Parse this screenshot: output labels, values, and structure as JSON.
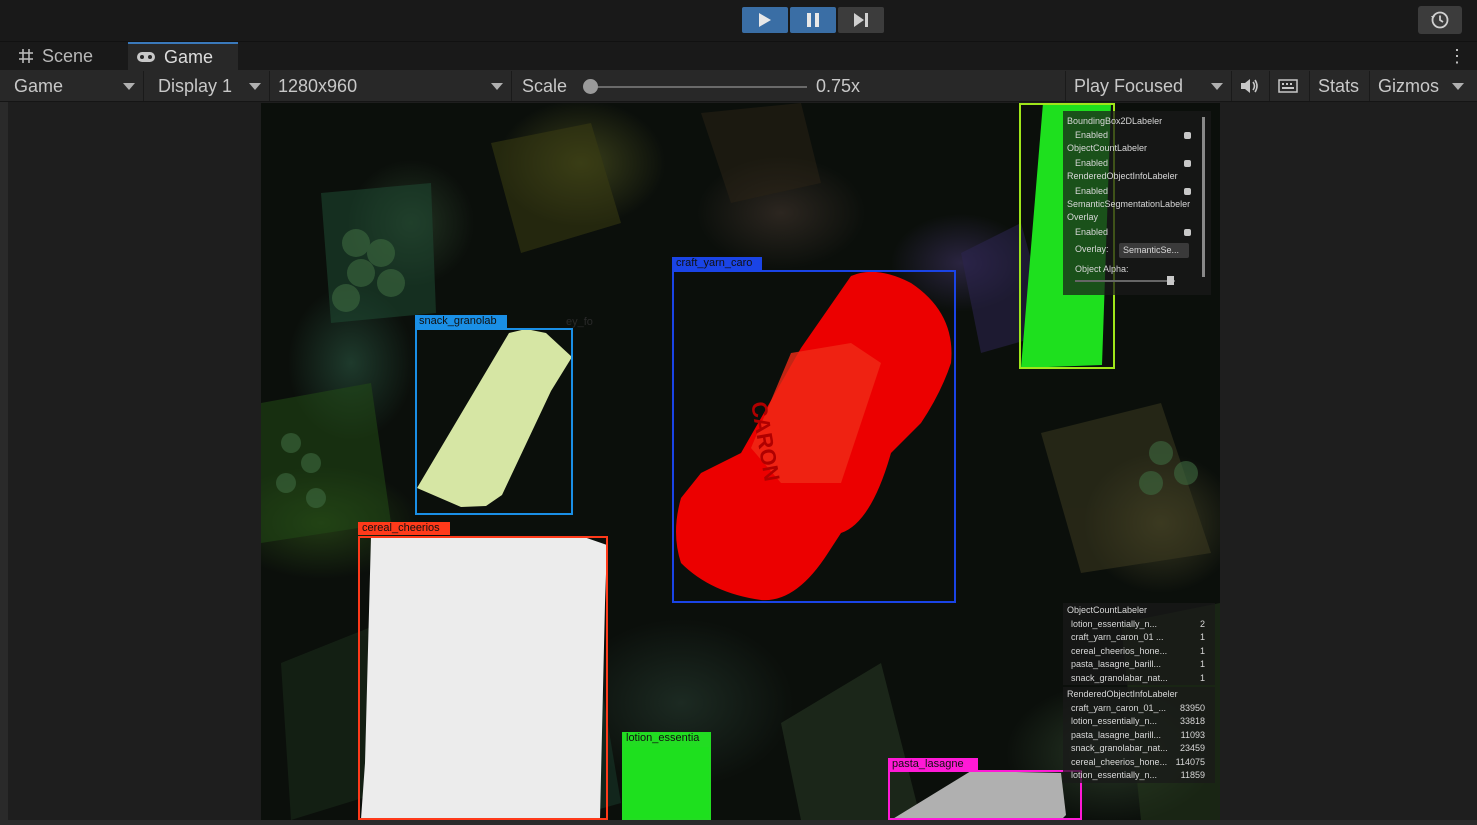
{
  "toolbar": {
    "play_icon": "play-icon",
    "pause_icon": "pause-icon",
    "step_icon": "step-icon",
    "history_icon": "history-icon"
  },
  "tabs": [
    {
      "label": "Scene",
      "icon": "grid-icon"
    },
    {
      "label": "Game",
      "icon": "gamepad-icon"
    }
  ],
  "gamebar": {
    "view_mode": "Game",
    "display": "Display 1",
    "resolution": "1280x960",
    "scale_label": "Scale",
    "scale_value": "0.75x",
    "scale_fraction": 0.03,
    "play_mode": "Play Focused",
    "stats": "Stats",
    "gizmos": "Gizmos"
  },
  "scene": {
    "bboxes": [
      {
        "label": "craft_yarn_caro",
        "color": "#1a44e6"
      },
      {
        "label": "snack_granolab",
        "color": "#1a8fe6"
      },
      {
        "label": "cereal_cheerios",
        "color": "#ff3a1a"
      },
      {
        "label": "lotion_essentia",
        "color": "#22dd22"
      },
      {
        "label": "pasta_lasagne",
        "color": "#ff19d6"
      },
      {
        "label": "",
        "color": "#9fe61a"
      }
    ],
    "fragment_text": "ey_fo",
    "brand_text": "CARON"
  },
  "labeler_panel": {
    "rows": [
      {
        "text": "BoundingBox2DLabeler"
      },
      {
        "text": "Enabled"
      },
      {
        "text": "ObjectCountLabeler"
      },
      {
        "text": "Enabled"
      },
      {
        "text": "RenderedObjectInfoLabeler"
      },
      {
        "text": "Enabled"
      },
      {
        "text": "SemanticSegmentationLabeler"
      },
      {
        "text": "Overlay"
      },
      {
        "text": "Enabled"
      }
    ],
    "overlay_label": "Overlay:",
    "overlay_value": "SemanticSe...",
    "alpha_label": "Object Alpha:"
  },
  "object_count": {
    "title": "ObjectCountLabeler",
    "rows": [
      {
        "name": "lotion_essentially_n...",
        "value": "2"
      },
      {
        "name": "craft_yarn_caron_01 ...",
        "value": "1"
      },
      {
        "name": "cereal_cheerios_hone...",
        "value": "1"
      },
      {
        "name": "pasta_lasagne_barill...",
        "value": "1"
      },
      {
        "name": "snack_granolabar_nat...",
        "value": "1"
      }
    ]
  },
  "rendered_info": {
    "title": "RenderedObjectInfoLabeler",
    "rows": [
      {
        "name": "craft_yarn_caron_01_...",
        "value": "83950"
      },
      {
        "name": "lotion_essentially_n...",
        "value": "33818"
      },
      {
        "name": "pasta_lasagne_barill...",
        "value": "11093"
      },
      {
        "name": "snack_granolabar_nat...",
        "value": "23459"
      },
      {
        "name": "cereal_cheerios_hone...",
        "value": "114075"
      },
      {
        "name": "lotion_essentially_n...",
        "value": "11859"
      }
    ]
  }
}
